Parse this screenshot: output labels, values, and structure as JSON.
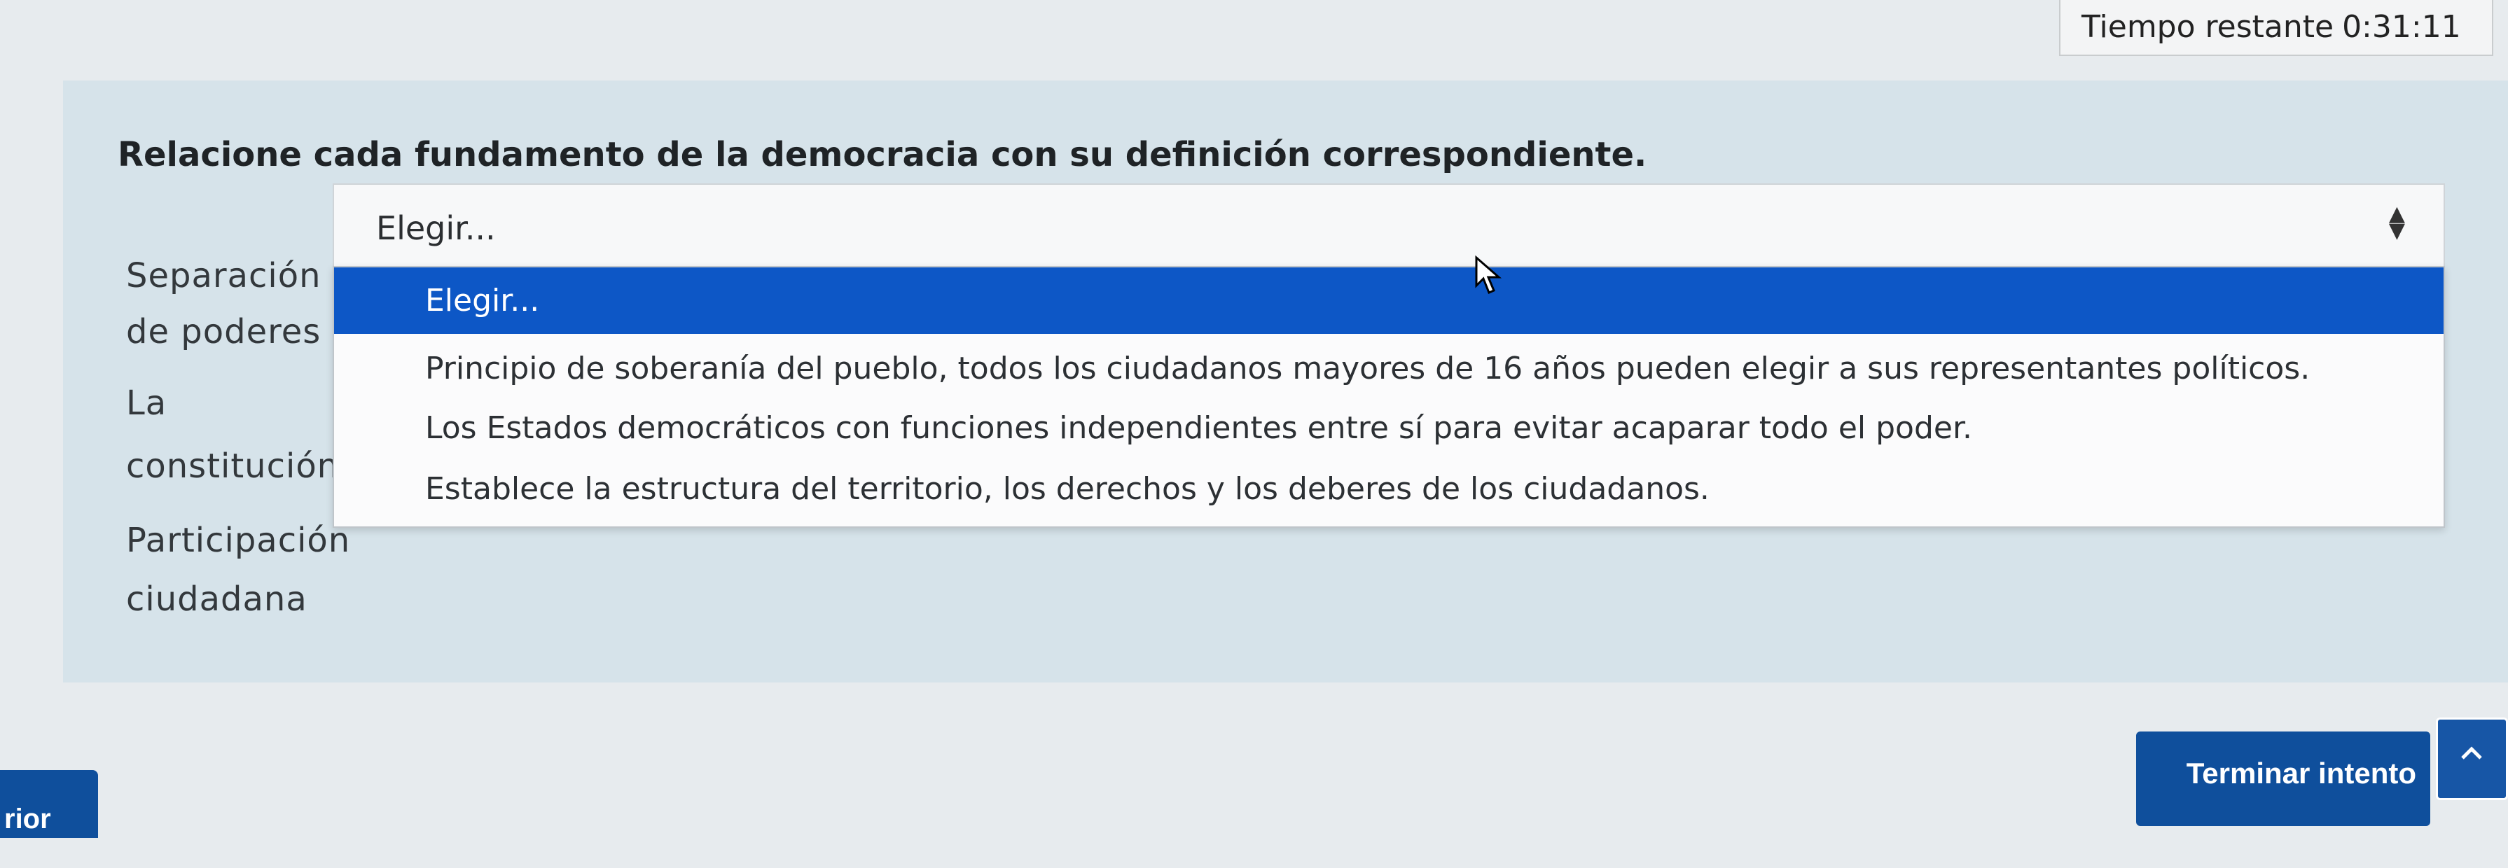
{
  "timer": {
    "label": "Tiempo restante",
    "value": "0:31:11"
  },
  "question": {
    "text": "Relacione cada fundamento de la democracia con su definición correspondiente.",
    "items": [
      {
        "line1": "Separación",
        "line2": "de poderes"
      },
      {
        "line1": "La",
        "line2": "constitución"
      },
      {
        "line1": "Participación",
        "line2": "ciudadana"
      }
    ],
    "select_value": "Elegir...",
    "options": [
      "Elegir...",
      "Principio de soberanía del pueblo, todos los ciudadanos mayores de 16 años pueden elegir a sus representantes políticos.",
      "Los Estados democráticos con funciones independientes entre sí para evitar acaparar todo el poder.",
      "Establece la estructura del territorio, los derechos y los deberes de los ciudadanos."
    ]
  },
  "nav": {
    "finish_label": "Terminar intento",
    "prev_label": "rior"
  },
  "colors": {
    "selected": "#0d57c6",
    "button": "#0f4f9c",
    "panel": "#d6e3ea"
  }
}
